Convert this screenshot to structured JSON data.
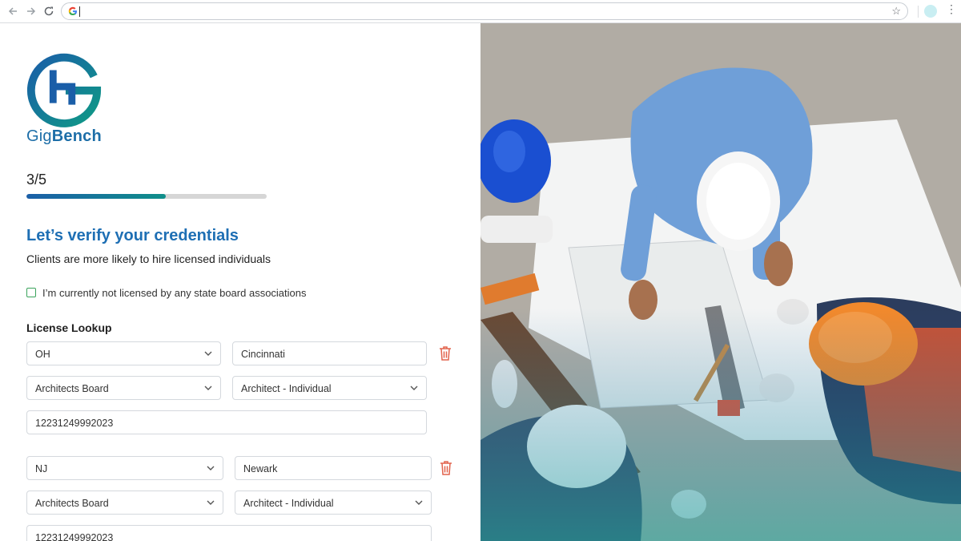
{
  "browser": {
    "url": "",
    "icons": [
      "back-arrow-icon",
      "forward-arrow-icon",
      "reload-icon",
      "google-icon",
      "bookmark-star-icon",
      "profile-avatar",
      "menu-dots-icon"
    ]
  },
  "brand": {
    "name_part1": "Gig",
    "name_part2": "Bench"
  },
  "progress": {
    "label": "3/5",
    "fraction": 0.58
  },
  "heading": "Let’s verify your credentials",
  "subheading": "Clients are more likely to hire licensed individuals",
  "not_licensed": {
    "label": "I’m currently not licensed by any state board associations",
    "checked": false
  },
  "license_lookup": {
    "title": "License Lookup",
    "entries": [
      {
        "state": "OH",
        "city": "Cincinnati",
        "board": "Architects Board",
        "license_type": "Architect - Individual",
        "license_number": "12231249992023"
      },
      {
        "state": "NJ",
        "city": "Newark",
        "board": "Architects Board",
        "license_type": "Architect - Individual",
        "license_number": "12231249992023"
      }
    ]
  },
  "colors": {
    "brand_blue": "#1e6fb4",
    "brand_teal": "#0f8f8a",
    "checkbox_green": "#3aa35b",
    "delete_red": "#e2634d"
  }
}
